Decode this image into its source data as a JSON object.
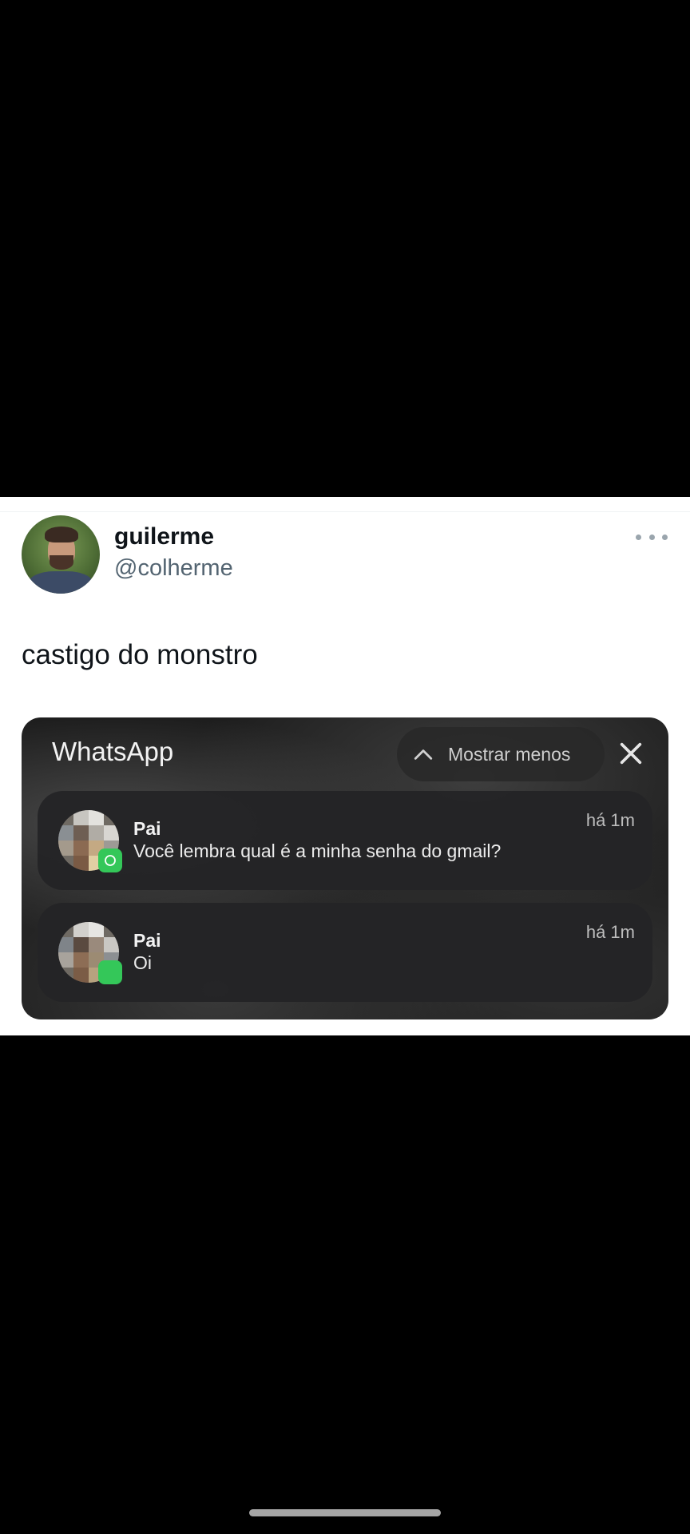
{
  "tweet": {
    "display_name": "guilerme",
    "handle": "@colherme",
    "text": "castigo do monstro",
    "more_icon": "more-horizontal-icon"
  },
  "media": {
    "app_name": "WhatsApp",
    "show_less_label": "Mostrar menos",
    "icons": {
      "collapse": "chevron-up-icon",
      "close": "close-icon",
      "badge": "whatsapp-icon"
    },
    "notifications": [
      {
        "sender": "Pai",
        "message": "Você lembra qual é a minha senha do gmail?",
        "time": "há 1m"
      },
      {
        "sender": "Pai",
        "message": "Oi",
        "time": "há 1m"
      }
    ]
  },
  "colors": {
    "background": "#000000",
    "tweet_bg": "#ffffff",
    "handle": "#536471",
    "whatsapp_green": "#34c759"
  }
}
